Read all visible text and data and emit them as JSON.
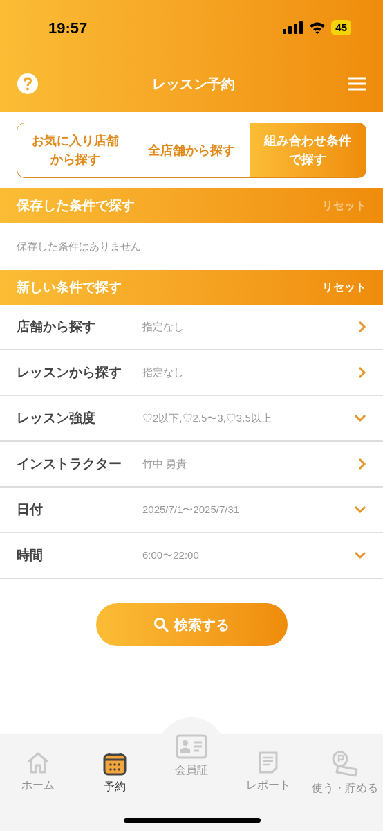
{
  "status_bar": {
    "time": "19:57",
    "battery": "45"
  },
  "header": {
    "title": "レッスン予約"
  },
  "tabs": [
    {
      "label": "お気に入り店舗から探す",
      "selected": false
    },
    {
      "label": "全店舗から探す",
      "selected": false
    },
    {
      "label": "組み合わせ条件で探す",
      "selected": true
    }
  ],
  "saved_section": {
    "title": "保存した条件で探す",
    "reset": {
      "label": "リセット",
      "disabled": true
    },
    "empty_message": "保存した条件はありません"
  },
  "new_section": {
    "title": "新しい条件で探す",
    "reset": {
      "label": "リセット",
      "disabled": false
    },
    "rows": [
      {
        "label": "店舗から探す",
        "value": "指定なし",
        "kind": "link"
      },
      {
        "label": "レッスンから探す",
        "value": "指定なし",
        "kind": "link"
      },
      {
        "label": "レッスン強度",
        "value": "♡2以下,♡2.5〜3,♡3.5以上",
        "kind": "dropdown"
      },
      {
        "label": "インストラクター",
        "value": "竹中 勇貴",
        "kind": "link"
      },
      {
        "label": "日付",
        "value": "2025/7/1〜2025/7/31",
        "kind": "dropdown"
      },
      {
        "label": "時間",
        "value": "6:00〜22:00",
        "kind": "dropdown"
      }
    ]
  },
  "search_button": "検索する",
  "bottom_nav": [
    {
      "label": "ホーム",
      "kind": "home",
      "selected": false
    },
    {
      "label": "予約",
      "kind": "calendar",
      "selected": true
    },
    {
      "label": "会員証",
      "kind": "card",
      "selected": false
    },
    {
      "label": "レポート",
      "kind": "report",
      "selected": false
    },
    {
      "label": "使う・貯める",
      "kind": "points",
      "selected": false
    }
  ]
}
